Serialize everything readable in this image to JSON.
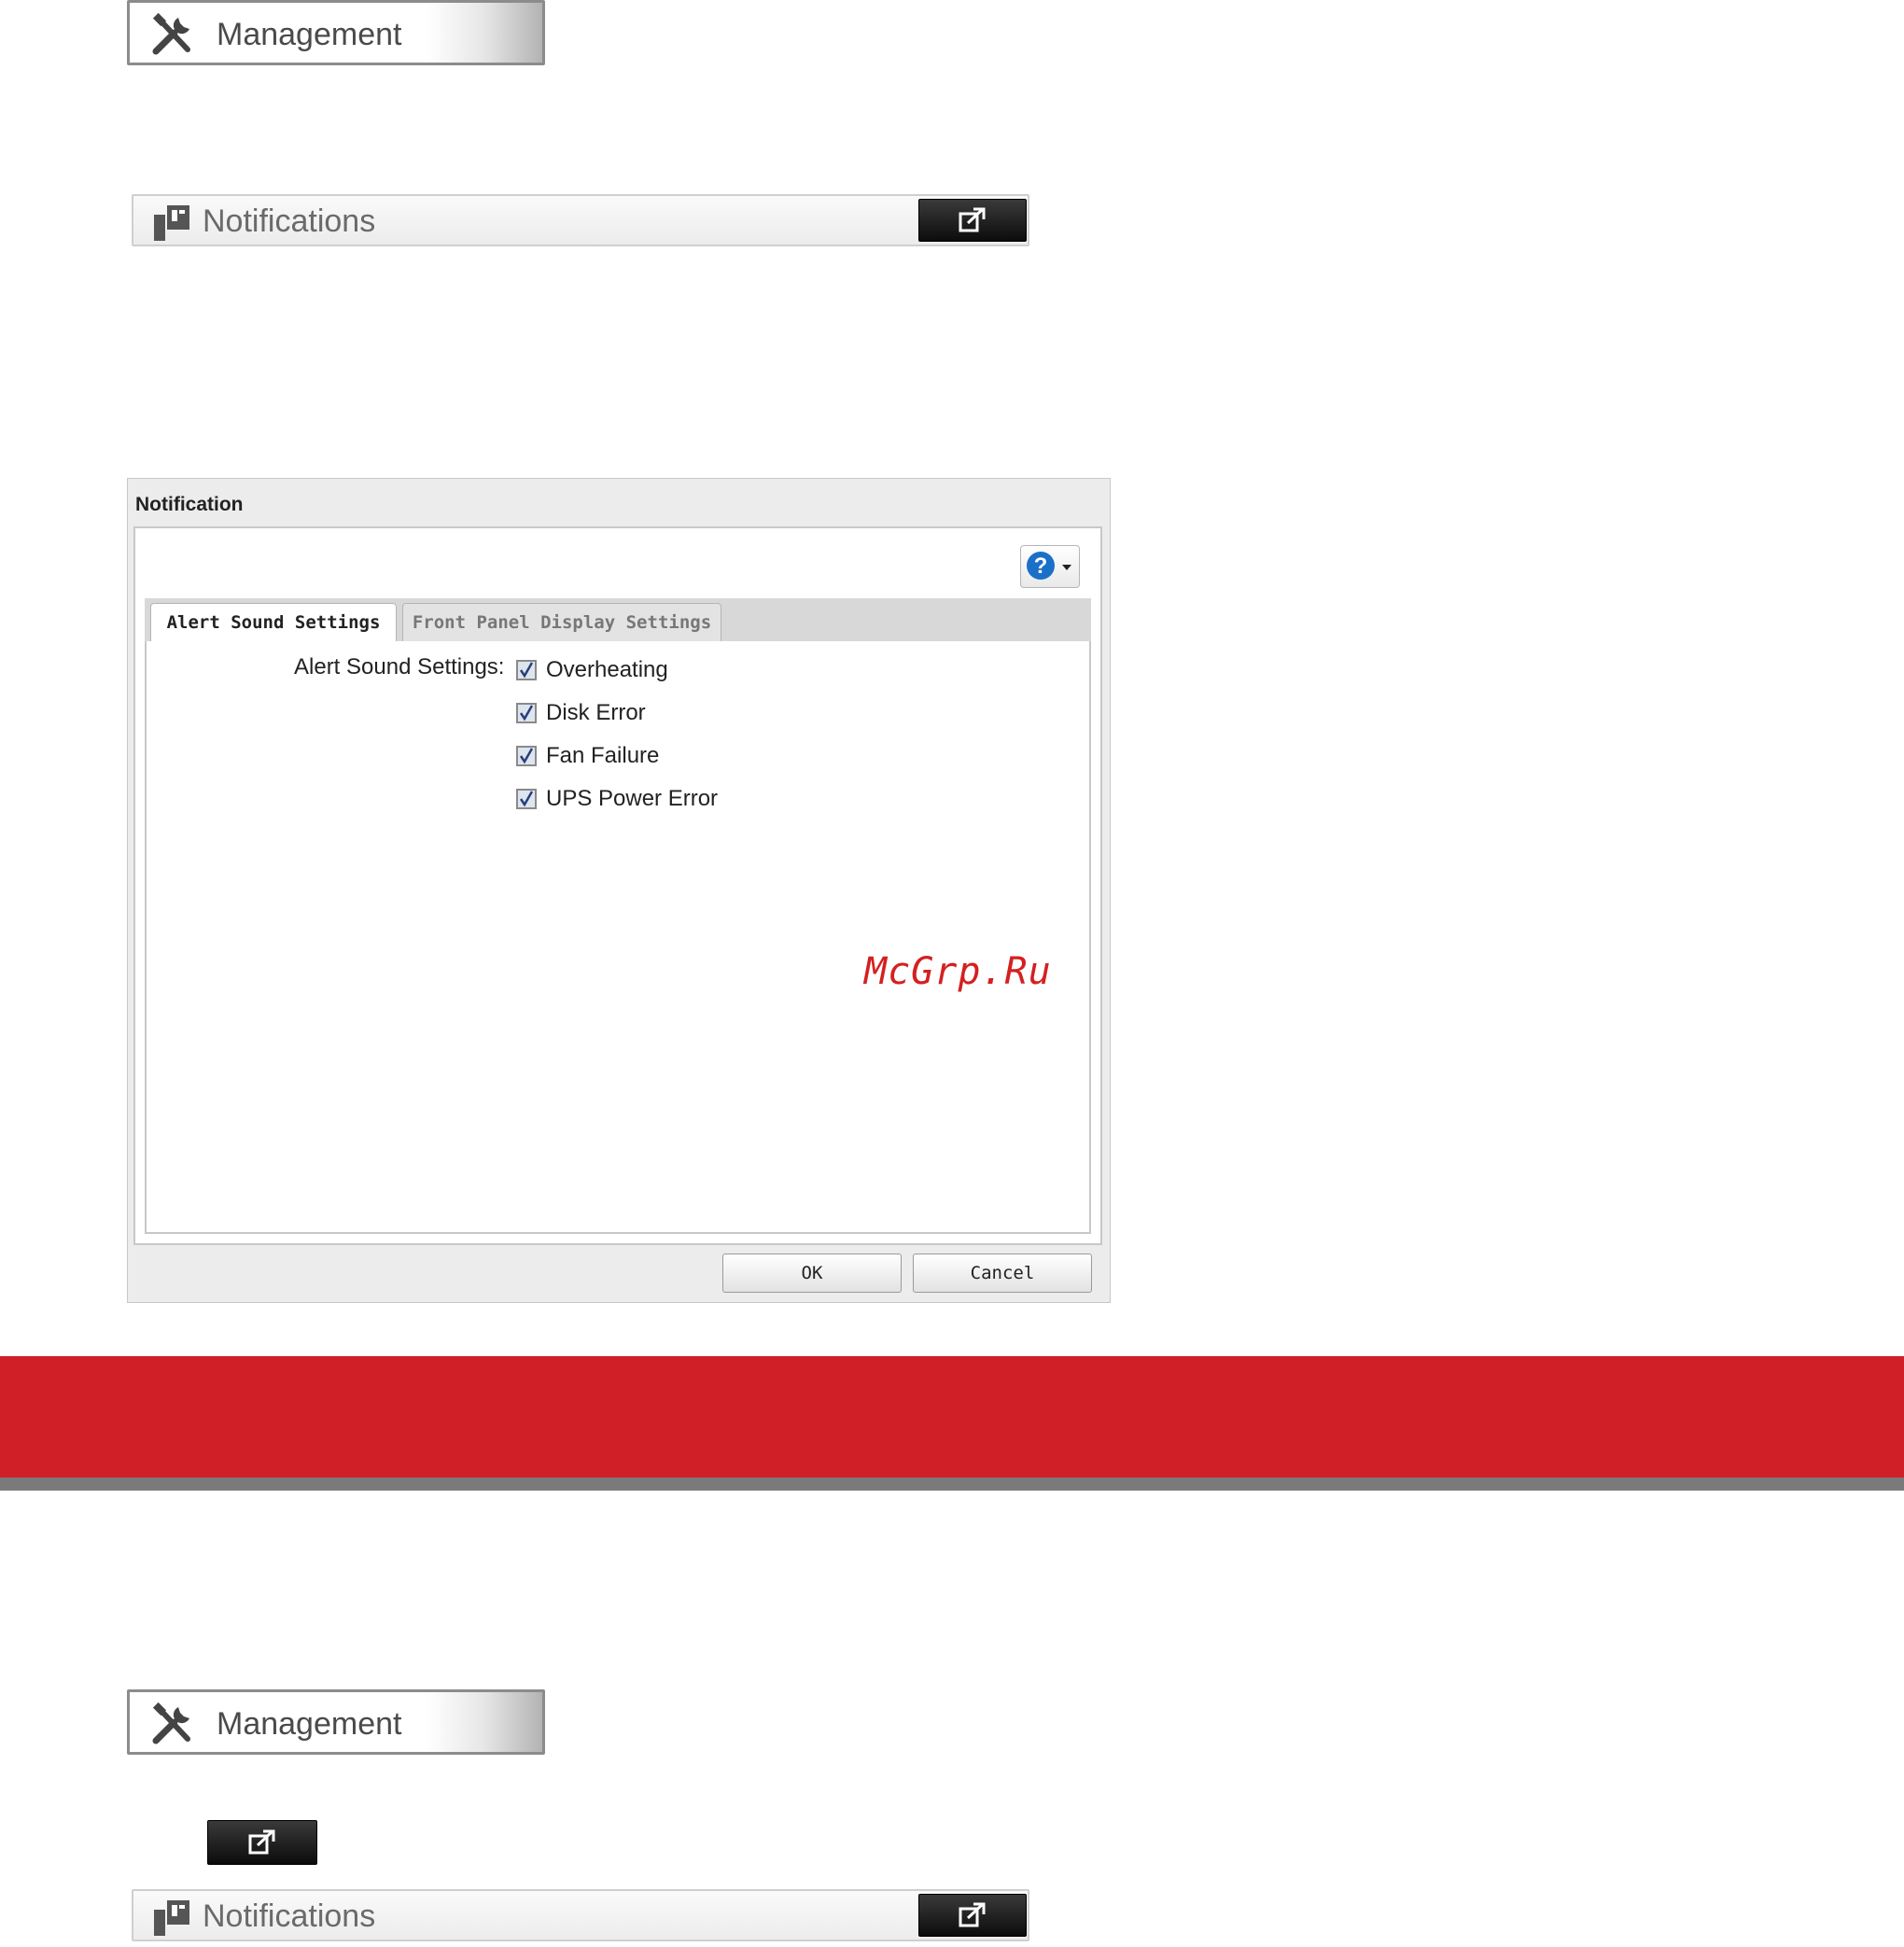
{
  "top_section": {
    "management_label": "Management",
    "notifications_label": "Notifications"
  },
  "dialog": {
    "title": "Notification",
    "help_icon": "question-icon",
    "tabs": [
      {
        "label": "Alert Sound Settings",
        "active": true
      },
      {
        "label": "Front Panel Display Settings",
        "active": false
      }
    ],
    "field_label": "Alert Sound Settings:",
    "checkboxes": [
      {
        "label": "Overheating",
        "checked": true
      },
      {
        "label": "Disk Error",
        "checked": true
      },
      {
        "label": "Fan Failure",
        "checked": true
      },
      {
        "label": "UPS Power Error",
        "checked": true
      }
    ],
    "ok_label": "OK",
    "cancel_label": "Cancel"
  },
  "watermark": "McGrp.Ru",
  "bottom_section": {
    "management_label": "Management",
    "notifications_label": "Notifications"
  },
  "colors": {
    "accent_red": "#d01f26",
    "help_blue": "#1a6fc9"
  }
}
